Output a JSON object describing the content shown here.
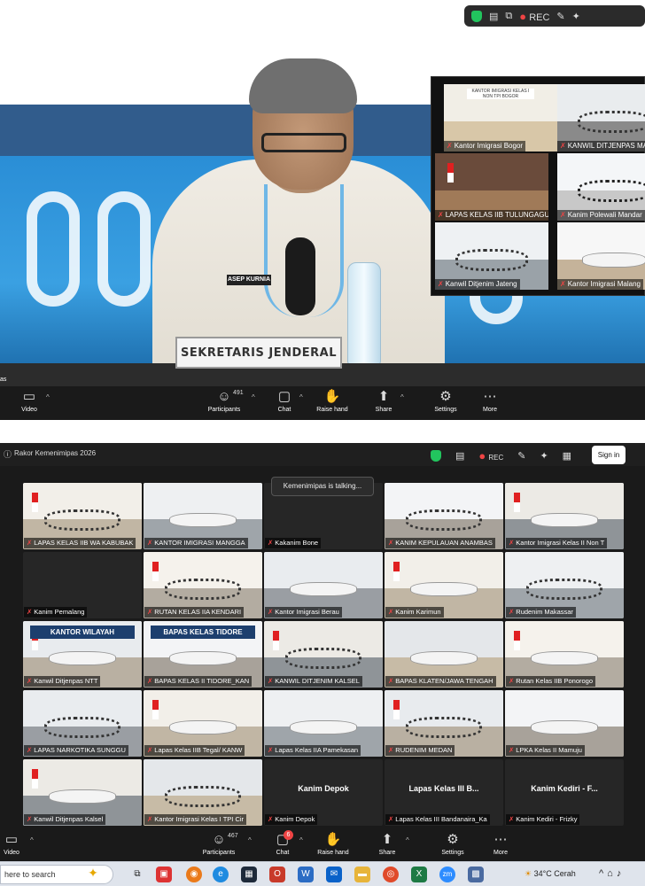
{
  "top": {
    "nameplate": "SEKRETARIS JENDERAL",
    "name_badge": "ASEP KURNIA",
    "edge_clip": "as",
    "toolbar": {
      "rec": "REC"
    },
    "gallery": [
      {
        "label": "Kantor Imigrasi Bogor",
        "sign": "KANTOR IMIGRASI KELAS I NON TPI BOGOR"
      },
      {
        "label": "KANWIL DITJENPAS MA"
      },
      {
        "label": "LAPAS KELAS IIB TULUNGAGUNG"
      },
      {
        "label": "Kanim Polewali Mandar"
      },
      {
        "label": "Kanwil Ditjenim Jateng"
      },
      {
        "label": "Kantor Imigrasi Malang"
      }
    ],
    "controls": {
      "video": "Video",
      "participants": "Participants",
      "participants_count": "491",
      "chat": "Chat",
      "raise_hand": "Raise hand",
      "share": "Share",
      "settings": "Settings",
      "more": "More"
    }
  },
  "bottom": {
    "window_title": "Rakor Kemenimipas 2026",
    "rec": "REC",
    "sign_in": "Sign in",
    "talking": "Kemenimipas is talking...",
    "tiles": [
      {
        "label": "LAPAS KELAS IIB WA KABUBAK"
      },
      {
        "label": "KANTOR IMIGRASI MANGGA"
      },
      {
        "label": "Kakanim Bone",
        "black": true
      },
      {
        "label": "KANIM KEPULAUAN ANAMBAS"
      },
      {
        "label": "Kantor Imigrasi Kelas II Non T"
      },
      {
        "label": "Kanim Pemalang",
        "black": true
      },
      {
        "label": "RUTAN KELAS IIA KENDARI"
      },
      {
        "label": "Kantor Imigrasi Berau"
      },
      {
        "label": "Kanim Karimun"
      },
      {
        "label": "Rudenim Makassar"
      },
      {
        "label": "Kanwil Ditjenpas NTT",
        "sign": "KANTOR WILAYAH"
      },
      {
        "label": "BAPAS KELAS II TIDORE_KAN",
        "sign": "BAPAS KELAS TIDORE"
      },
      {
        "label": "KANWIL DITJENIM KALSEL"
      },
      {
        "label": "BAPAS KLATEN/JAWA TENGAH"
      },
      {
        "label": "Rutan Kelas IIB Ponorogo"
      },
      {
        "label": "LAPAS NARKOTIKA SUNGGU"
      },
      {
        "label": "Lapas Kelas IIB Tegal/ KANW"
      },
      {
        "label": "Lapas Kelas IIA Pamekasan"
      },
      {
        "label": "RUDENIM MEDAN"
      },
      {
        "label": "LPKA Kelas II Mamuju"
      },
      {
        "label": "Kanwil Ditjenpas Kalsel"
      },
      {
        "label": "Kantor Imigrasi Kelas I TPI Cir"
      },
      {
        "label": "Kanim Depok",
        "black": true,
        "big": "Kanim Depok"
      },
      {
        "label": "Lapas Kelas III Bandanaira_Ka",
        "black": true,
        "big": "Lapas Kelas III B..."
      },
      {
        "label": "Kanim Kediri - Frizky",
        "black": true,
        "big": "Kanim Kediri - F..."
      }
    ],
    "controls": {
      "video": "Video",
      "participants": "Participants",
      "participants_count": "467",
      "chat": "Chat",
      "chat_badge": "6",
      "raise_hand": "Raise hand",
      "share": "Share",
      "settings": "Settings",
      "more": "More"
    }
  },
  "taskbar": {
    "search": "here to search",
    "weather": "34°C  Cerah",
    "zoom": "zm"
  },
  "colors": {
    "mic_off": "#ef4444",
    "shield": "#22c55e",
    "toolbar_bg": "#1a1a1a"
  }
}
